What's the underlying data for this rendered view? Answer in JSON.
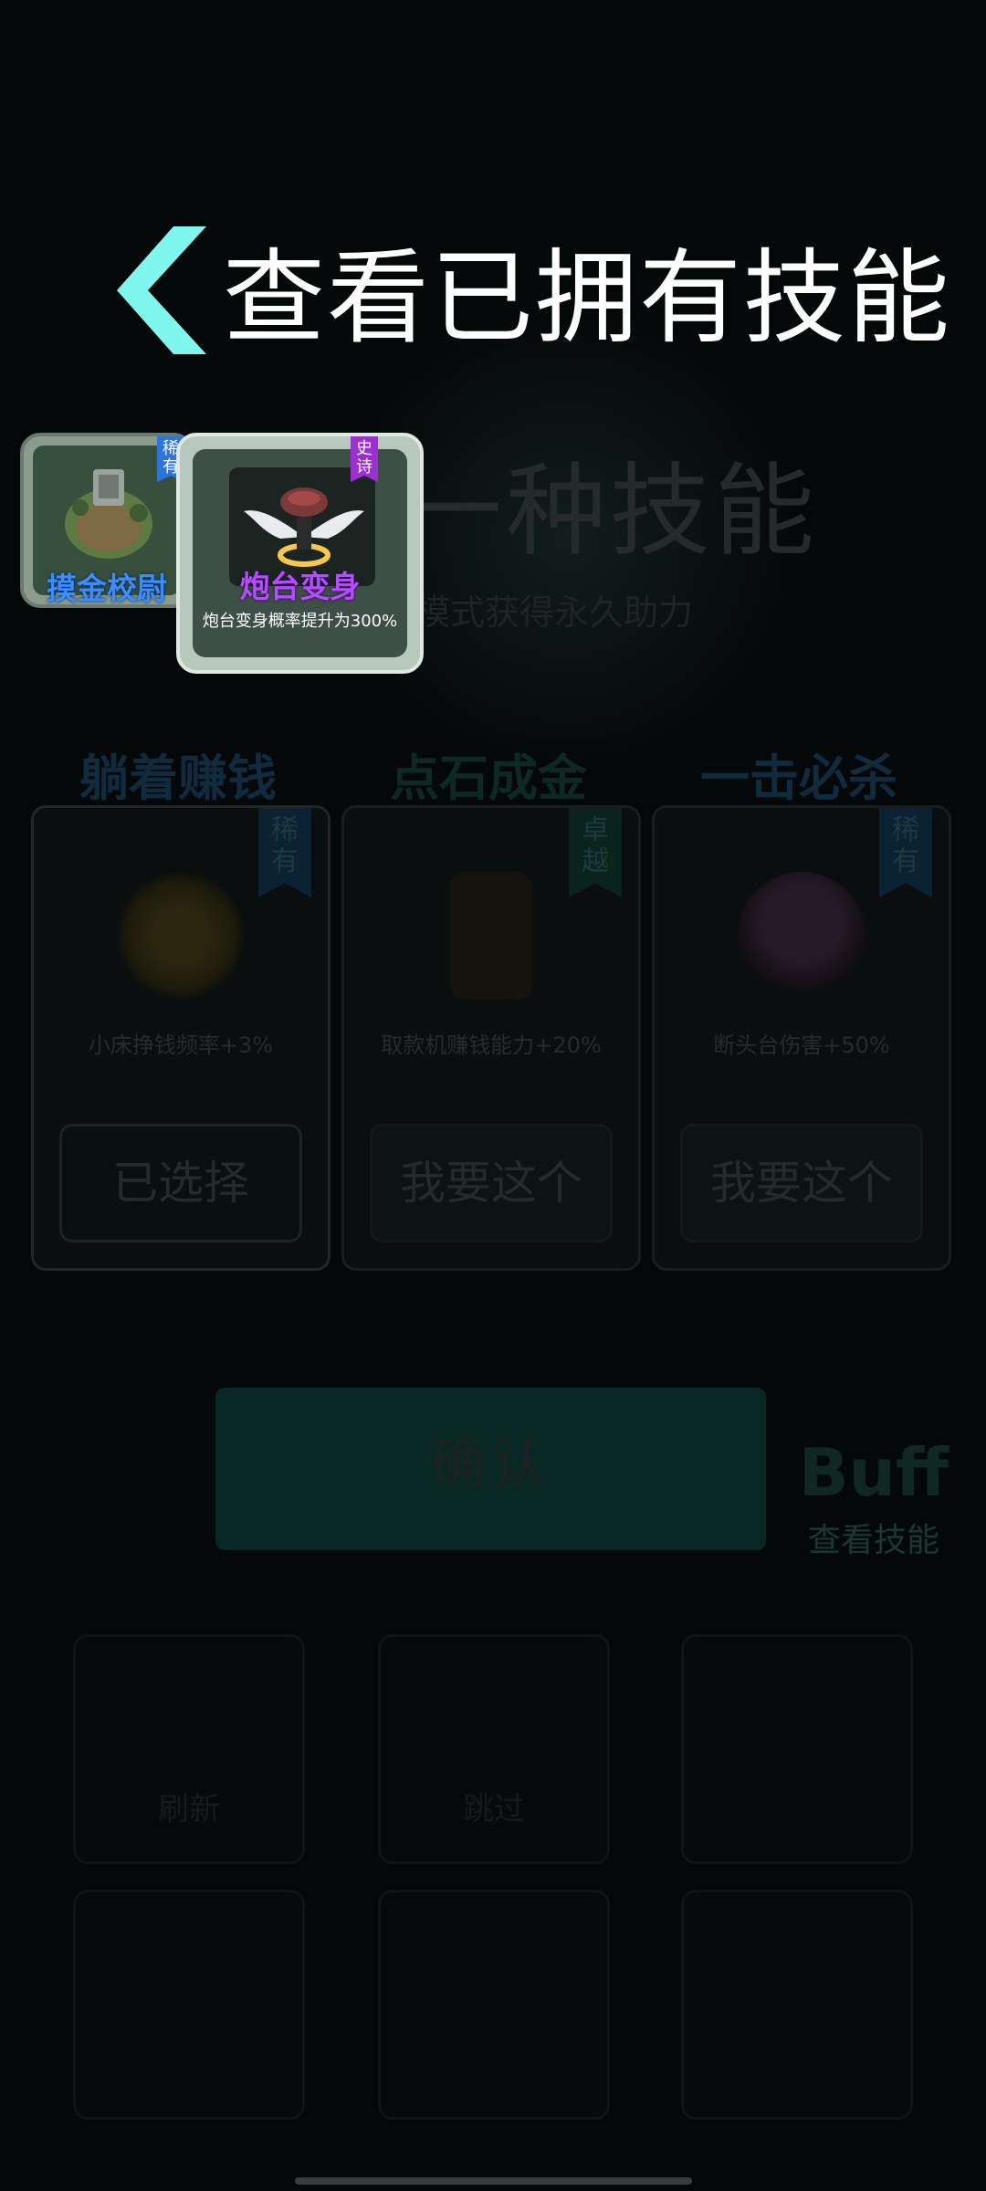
{
  "header": {
    "back_icon": "chevron-left-icon",
    "title": "查看已拥有技能"
  },
  "owned_skills": [
    {
      "name": "摸金校尉",
      "rarity": "稀有",
      "rarity_color": "#2e74d8",
      "name_color": "#3a8cff",
      "icon": "tomb-stone-icon"
    },
    {
      "name": "炮台变身",
      "rarity": "史诗",
      "rarity_color": "#9b2fcf",
      "name_color": "#b44cff",
      "icon": "winged-halo-icon",
      "description": "炮台变身概率提升为300%"
    }
  ],
  "background": {
    "title": "一种技能",
    "subtitle": "模式获得永久助力",
    "cards": [
      {
        "name": "躺着赚钱",
        "name_color": "#0f2b3d",
        "rarity": "稀有",
        "rarity_color": "#0b2233",
        "description": "小床挣钱频率+3%",
        "button": "已选择",
        "selected": true,
        "icon": "gold-coin-icon"
      },
      {
        "name": "点石成金",
        "name_color": "#0d2a22",
        "rarity": "卓越",
        "rarity_color": "#0a241d",
        "description": "取款机赚钱能力+20%",
        "button": "我要这个",
        "selected": false,
        "icon": "atm-machine-icon"
      },
      {
        "name": "一击必杀",
        "name_color": "#0f2b3d",
        "rarity": "稀有",
        "rarity_color": "#0b2233",
        "description": "断头台伤害+50%",
        "button": "我要这个",
        "selected": false,
        "icon": "guillotine-orb-icon"
      }
    ],
    "confirm_label": "确认",
    "buff_word": "Buff",
    "buff_label": "查看技能",
    "slot_labels": [
      "刷新",
      "跳过"
    ]
  },
  "colors": {
    "back_arrow": "#7ff7ee",
    "header_text": "#ffffff"
  }
}
